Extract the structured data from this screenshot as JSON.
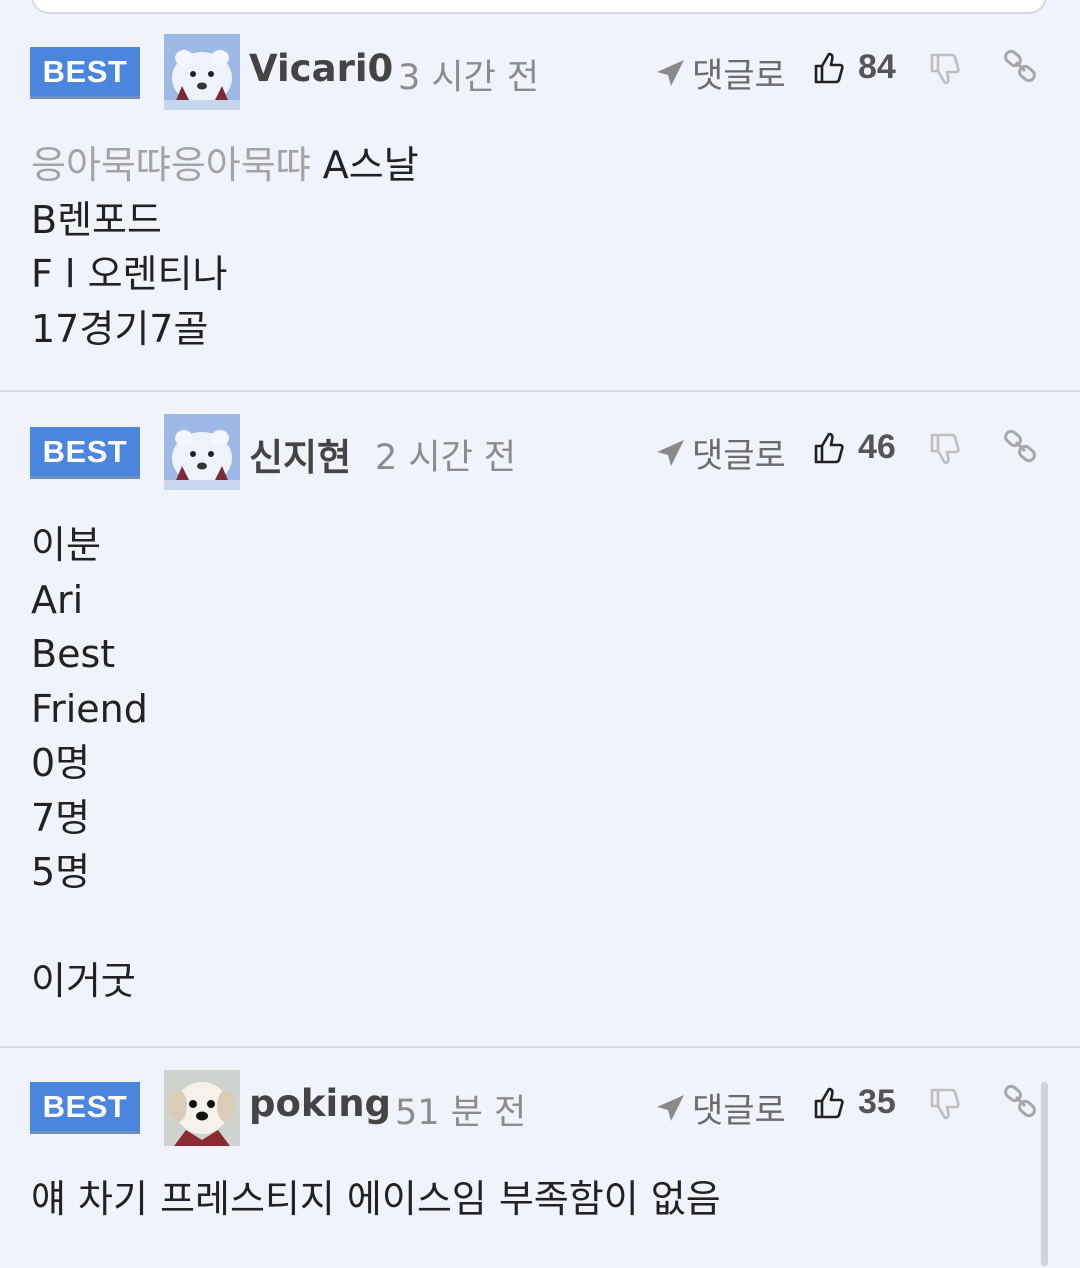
{
  "comments": [
    {
      "badge": "BEST",
      "username": "Vicari0",
      "time": "3 시간 전",
      "reply_label": "댓글로",
      "likes": "84",
      "quote": "응아묵땨응아묵땨",
      "lines": [
        "A스날",
        "B렌포드",
        "F l 오렌티나",
        "17경기7골"
      ]
    },
    {
      "badge": "BEST",
      "username": "신지현",
      "time": "2 시간 전",
      "reply_label": "댓글로",
      "likes": "46",
      "lines": [
        "이분",
        "Ari",
        "Best",
        "Friend",
        "0명",
        "7명",
        "5명",
        "",
        "이거굿"
      ]
    },
    {
      "badge": "BEST",
      "username": "poking",
      "time": "51 분 전",
      "reply_label": "댓글로",
      "likes": "35",
      "lines": [
        "얘 차기 프레스티지 에이스임 부족함이 없음"
      ]
    }
  ],
  "colors": {
    "background": "#f1f3fb",
    "badge": "#4a86de",
    "divider": "#d9dbe2"
  },
  "icons": [
    "send-arrow-icon",
    "thumbs-up-icon",
    "thumbs-down-icon",
    "link-icon",
    "polar-bear-avatar",
    "dog-avatar"
  ]
}
